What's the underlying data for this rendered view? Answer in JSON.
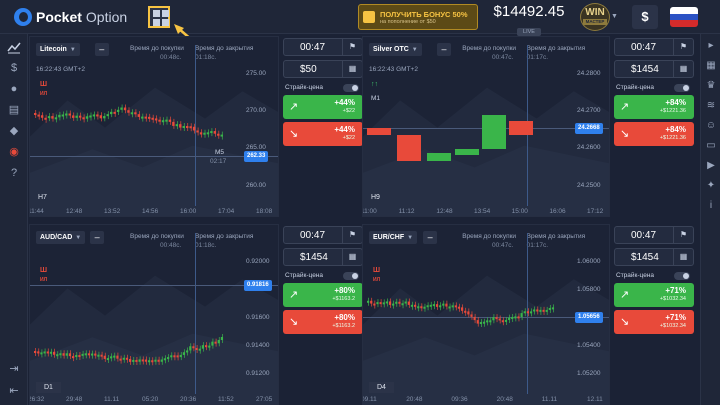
{
  "brand": {
    "name_bold": "Pocket",
    "name_regular": "Option"
  },
  "bonus": {
    "title": "ПОЛУЧИТЬ БОНУС 50%",
    "subtitle": "на пополнение от $50"
  },
  "balance": {
    "value": "$14492.45",
    "mode": "LIVE"
  },
  "win": {
    "label": "WIN",
    "sub": "МАСТЕР"
  },
  "currency_symbol": "$",
  "colors": {
    "bg": "#1b2235",
    "up": "#3ab54a",
    "down": "#e84a3a",
    "accent": "#2f80ed",
    "highlight": "#f6c343"
  },
  "icons": {
    "trend": "chart-line-icon",
    "dollar": "dollar-icon",
    "users": "users-icon",
    "cart": "cart-icon",
    "diamond": "diamond-icon",
    "eye": "eye-icon",
    "help": "question-icon",
    "logout": "logout-icon",
    "exit": "exit-icon"
  },
  "panels": [
    {
      "asset": "Litecoin",
      "hdr1": "Время до покупки",
      "hdr2": "Время до закрытия",
      "hdr1v": "00:48с.",
      "hdr2v": "01:18с.",
      "timestamp": "16:22:43 GMT+2",
      "timeframe": "H7",
      "sub_tf": "M5",
      "sub_val": "02:17",
      "price_badge": "262.33",
      "red_lbl": "Ш",
      "red_sub": "ИЛ",
      "y_labels": [
        "275.00",
        "270.00",
        "265.00",
        "260.00"
      ],
      "x_labels": [
        "11:44",
        "12:48",
        "13:52",
        "14:56",
        "16:00",
        "17:04",
        "18:08"
      ],
      "trade": {
        "time": "00:47",
        "amount": "$50",
        "strike": "Страйк-цена",
        "up_pct": "+44%",
        "up_sub": "+$22",
        "down_pct": "+44%",
        "down_sub": "+$22"
      }
    },
    {
      "asset": "Silver OTC",
      "hdr1": "Время до покупки",
      "hdr2": "Время до закрытия",
      "hdr1v": "00:47с.",
      "hdr2v": "01:17с.",
      "timestamp": "16:22:43 GMT+2",
      "timeframe": "H9",
      "sub_tf": "M1",
      "price_badge": "24.2668",
      "green_lbl": "↑↑",
      "y_labels": [
        "24.2800",
        "24.2700",
        "24.2600",
        "24.2500"
      ],
      "x_labels": [
        "11:00",
        "11:12",
        "12:48",
        "13:54",
        "15:00",
        "16:06",
        "17:12"
      ],
      "trade": {
        "time": "00:47",
        "amount": "$1454",
        "strike": "Страйк-цена",
        "up_pct": "+84%",
        "up_sub": "+$1221.36",
        "down_pct": "+84%",
        "down_sub": "+$1221.36"
      }
    },
    {
      "asset": "AUD/CAD",
      "hdr1": "Время до покупки",
      "hdr2": "Время до закрытия",
      "hdr1v": "00:48с.",
      "hdr2v": "01:18с.",
      "timeframe": "D1",
      "price_badge": "0.91816",
      "red_lbl": "Ш",
      "red_sub": "ИЛ",
      "y_labels": [
        "0.92000",
        "0.91800",
        "0.91600",
        "0.91400",
        "0.91200"
      ],
      "x_labels": [
        "26:32",
        "29:48",
        "11.11",
        "05:20",
        "20:36",
        "11:52",
        "27:05"
      ],
      "trade": {
        "time": "00:47",
        "amount": "$1454",
        "strike": "Страйк-цена",
        "up_pct": "+80%",
        "up_sub": "+$1163.2",
        "down_pct": "+80%",
        "down_sub": "+$1163.2"
      }
    },
    {
      "asset": "EUR/CHF",
      "hdr1": "Время до покупки",
      "hdr2": "Время до закрытия",
      "hdr1v": "00:47с.",
      "hdr2v": "01:17с.",
      "timeframe": "D4",
      "price_badge": "1.05656",
      "red_lbl": "Ш",
      "red_sub": "ИЛ",
      "y_labels": [
        "1.06000",
        "1.05800",
        "1.05600",
        "1.05400",
        "1.05200"
      ],
      "x_labels": [
        "09.11",
        "20:48",
        "09:36",
        "20:48",
        "11.11",
        "12.11"
      ],
      "trade": {
        "time": "00:47",
        "amount": "$1454",
        "strike": "Страйк-цена",
        "up_pct": "+71%",
        "up_sub": "+$1032.34",
        "down_pct": "+71%",
        "down_sub": "+$1032.34"
      }
    }
  ]
}
